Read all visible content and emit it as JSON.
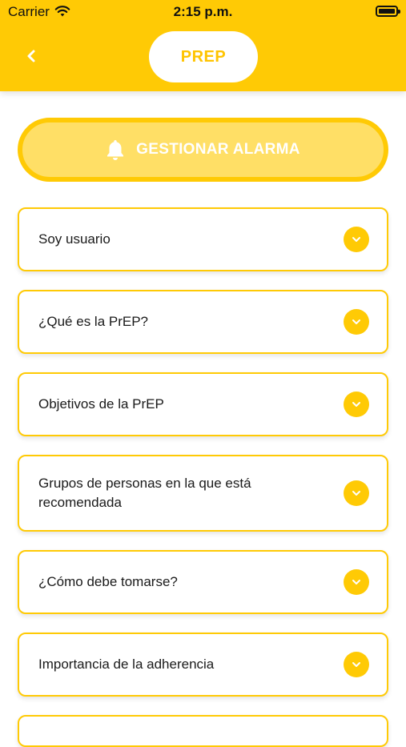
{
  "status_bar": {
    "carrier": "Carrier",
    "time": "2:15 p.m."
  },
  "header": {
    "back_icon": "chevron-left-icon",
    "title": "PREP"
  },
  "alarm_button": {
    "icon": "bell-icon",
    "label": "GESTIONAR ALARMA"
  },
  "faq": {
    "items": [
      {
        "label": "Soy usuario"
      },
      {
        "label": "¿Qué es la PrEP?"
      },
      {
        "label": "Objetivos de la PrEP"
      },
      {
        "label": "Grupos de personas en la que está recomendada"
      },
      {
        "label": "¿Cómo debe tomarse?"
      },
      {
        "label": "Importancia de la adherencia"
      }
    ]
  },
  "colors": {
    "accent": "#FFCA05",
    "accent_light": "#FFDF66",
    "text": "#1a1a1a"
  }
}
